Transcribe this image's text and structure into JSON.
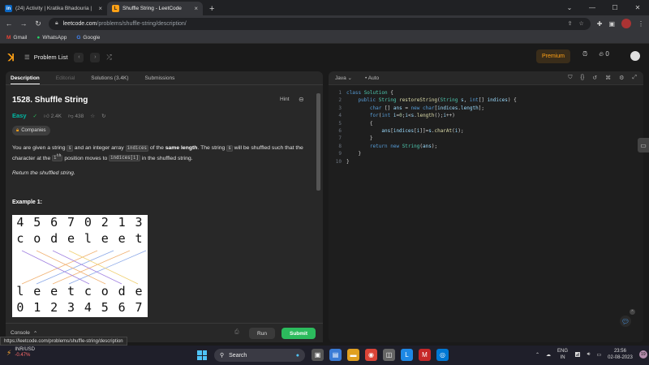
{
  "browser": {
    "tabs": [
      {
        "title": "(24) Activity | Kratika Bhadouria |",
        "icon": "linkedin-icon",
        "active": false
      },
      {
        "title": "Shuffle String - LeetCode",
        "icon": "leetcode-icon",
        "active": true
      }
    ],
    "new_tab": "+",
    "url_host": "leetcode.com",
    "url_path": "/problems/shuffle-string/description/",
    "bookmarks": [
      "Gmail",
      "WhatsApp",
      "Google"
    ]
  },
  "leetcode_nav": {
    "problem_list": "Problem List",
    "premium": "Premium",
    "streak": "0"
  },
  "left_tabs": [
    "Description",
    "Editorial",
    "Solutions (3.4K)",
    "Submissions"
  ],
  "problem": {
    "title": "1528. Shuffle String",
    "hint": "Hint",
    "difficulty": "Easy",
    "likes": "2.4K",
    "dislikes": "438",
    "companies": "Companies",
    "desc_p1_a": "You are given a string ",
    "desc_code_s": "s",
    "desc_p1_b": " and an integer array ",
    "desc_code_indices": "indices",
    "desc_p1_c": " of the ",
    "desc_bold": "same length",
    "desc_p1_d": ". The string ",
    "desc_p1_e": " will be shuffled such that the character at the ",
    "desc_code_ith": "i",
    "desc_sup": "th",
    "desc_p1_f": " position moves to ",
    "desc_code_indices_i": "indices[i]",
    "desc_p1_g": " in the shuffled string.",
    "desc_p2_a": "Return ",
    "desc_p2_b": "the shuffled string",
    "desc_p2_c": ".",
    "example_title": "Example 1:",
    "example_image": {
      "top_digits": [
        "4",
        "5",
        "6",
        "7",
        "0",
        "2",
        "1",
        "3"
      ],
      "top_letters": [
        "c",
        "o",
        "d",
        "e",
        "l",
        "e",
        "e",
        "t"
      ],
      "bottom_letters": [
        "l",
        "e",
        "e",
        "t",
        "c",
        "o",
        "d",
        "e"
      ],
      "bottom_digits": [
        "0",
        "1",
        "2",
        "3",
        "4",
        "5",
        "6",
        "7"
      ]
    }
  },
  "footer": {
    "console": "Console",
    "run": "Run",
    "submit": "Submit"
  },
  "editor": {
    "language": "Java",
    "mode": "Auto",
    "line_numbers": [
      "1",
      "2",
      "3",
      "4",
      "5",
      "6",
      "7",
      "8",
      "9",
      "10"
    ]
  },
  "status_url": "https://leetcode.com/problems/shuffle-string/description",
  "taskbar": {
    "ticker": "INR/USD",
    "change": "-0.47%",
    "search": "Search",
    "lang_top": "ENG",
    "lang_bottom": "IN",
    "time": "23:56",
    "date": "02-08-2023",
    "notifications": "19"
  }
}
